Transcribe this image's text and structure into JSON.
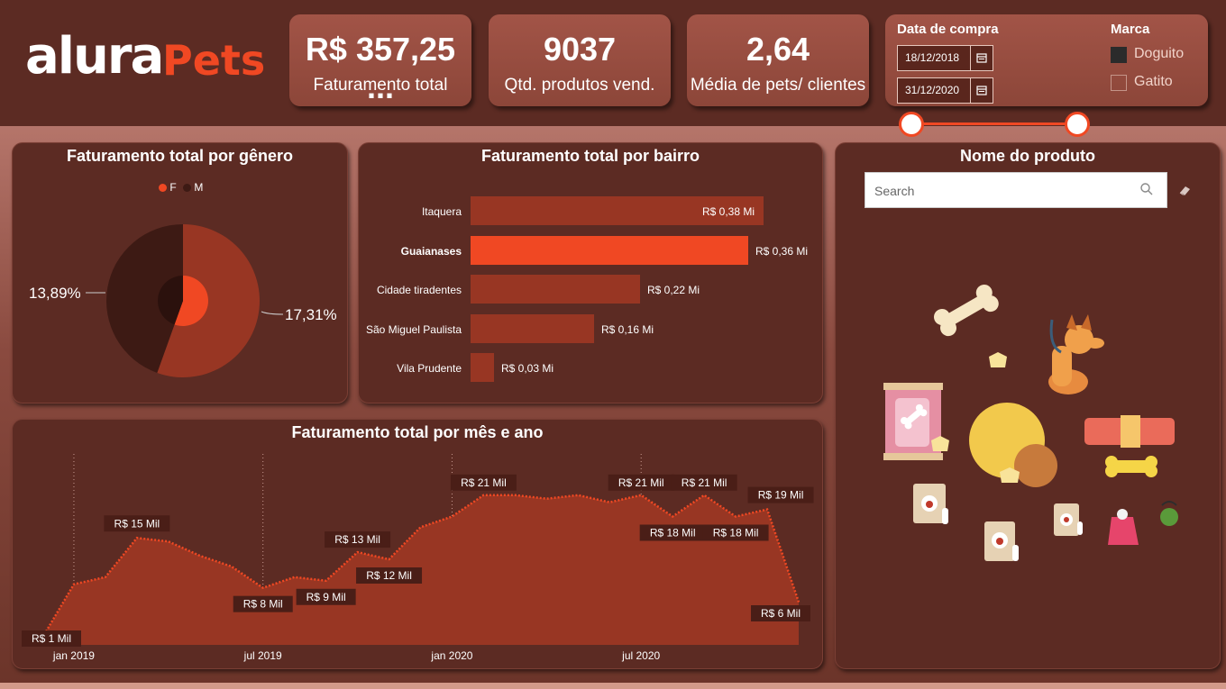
{
  "brand": {
    "logo_word1": "alura",
    "logo_word2": "Pets"
  },
  "kpis": [
    {
      "value": "R$ 357,25 ...",
      "label": "Faturamento total"
    },
    {
      "value": "9037",
      "label": "Qtd. produtos vend."
    },
    {
      "value": "2,64",
      "label": "Média de pets/ clientes"
    }
  ],
  "filters": {
    "date_title": "Data de compra",
    "date_start": "18/12/2018",
    "date_end": "31/12/2020",
    "brand_title": "Marca",
    "brands": [
      {
        "label": "Doguito",
        "checked": true
      },
      {
        "label": "Gatito",
        "checked": false
      }
    ]
  },
  "gender_chart": {
    "title": "Faturamento total por gênero",
    "legend": [
      "F",
      "M"
    ],
    "labels": [
      "13,89%",
      "17,31%"
    ],
    "colors": {
      "F": "#f04823",
      "M": "#3d1a14"
    }
  },
  "bairro_chart": {
    "title": "Faturamento total por bairro"
  },
  "month_chart": {
    "title": "Faturamento total por mês e ano",
    "x_ticks": [
      "jan 2019",
      "jul 2019",
      "jan 2020",
      "jul 2020"
    ]
  },
  "product_panel": {
    "title": "Nome do produto",
    "search_placeholder": "Search"
  },
  "chart_data": [
    {
      "type": "pie",
      "title": "Faturamento total por gênero",
      "categories": [
        "F",
        "M"
      ],
      "values": [
        17.31,
        13.89
      ],
      "labels": [
        "17,31%",
        "13,89%"
      ]
    },
    {
      "type": "bar",
      "title": "Faturamento total por bairro",
      "categories": [
        "Itaquera",
        "Guaianases",
        "Cidade tiradentes",
        "São Miguel Paulista",
        "Vila Prudente"
      ],
      "values": [
        0.38,
        0.36,
        0.22,
        0.16,
        0.03
      ],
      "labels": [
        "R$ 0,38 Mi",
        "R$ 0,36 Mi",
        "R$ 0,22 Mi",
        "R$ 0,16 Mi",
        "R$ 0,03 Mi"
      ],
      "highlight": "Guaianases",
      "unit": "R$ Mi"
    },
    {
      "type": "area",
      "title": "Faturamento total por mês e ano",
      "x": [
        "2018-12",
        "2019-01",
        "2019-02",
        "2019-03",
        "2019-04",
        "2019-05",
        "2019-06",
        "2019-07",
        "2019-08",
        "2019-09",
        "2019-10",
        "2019-11",
        "2019-12",
        "2020-01",
        "2020-02",
        "2020-03",
        "2020-04",
        "2020-05",
        "2020-06",
        "2020-07",
        "2020-08",
        "2020-09",
        "2020-10",
        "2020-11",
        "2020-12"
      ],
      "values": [
        1,
        8.5,
        9.5,
        15,
        14.5,
        12.5,
        11,
        8,
        9.5,
        9,
        13,
        12,
        16.5,
        18,
        21,
        21,
        20.5,
        21,
        20,
        21,
        18,
        21,
        18,
        19,
        6
      ],
      "labels": [
        {
          "x": "2018-12",
          "text": "R$ 1 Mil"
        },
        {
          "x": "2019-03",
          "text": "R$ 15 Mil"
        },
        {
          "x": "2019-07",
          "text": "R$ 8 Mil"
        },
        {
          "x": "2019-09",
          "text": "R$ 9 Mil"
        },
        {
          "x": "2019-10",
          "text": "R$ 13 Mil"
        },
        {
          "x": "2019-11",
          "text": "R$ 12 Mil"
        },
        {
          "x": "2020-02",
          "text": "R$ 21 Mil"
        },
        {
          "x": "2020-07",
          "text": "R$ 21 Mil"
        },
        {
          "x": "2020-08",
          "text": "R$ 18 Mil"
        },
        {
          "x": "2020-09",
          "text": "R$ 21 Mil"
        },
        {
          "x": "2020-10",
          "text": "R$ 18 Mil"
        },
        {
          "x": "2020-11",
          "text": "R$ 19 Mil"
        },
        {
          "x": "2020-12",
          "text": "R$ 6 Mil"
        }
      ],
      "ylim": [
        0,
        24
      ],
      "unit": "R$ Mil"
    }
  ]
}
